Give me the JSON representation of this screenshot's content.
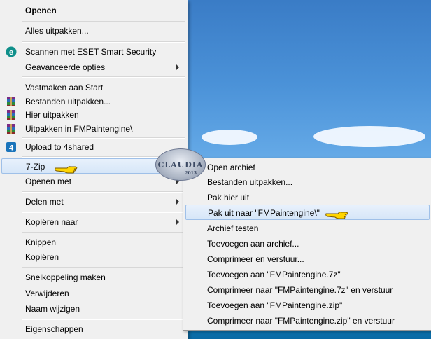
{
  "menu": {
    "items": [
      {
        "label": "Openen",
        "bold": true
      },
      {
        "label": "Alles uitpakken..."
      },
      {
        "label": "Scannen met ESET Smart Security",
        "icon": "eset-icon"
      },
      {
        "label": "Geavanceerde opties",
        "submenu": true
      },
      {
        "label": "Vastmaken aan Start"
      },
      {
        "label": "Bestanden uitpakken...",
        "icon": "winrar-icon"
      },
      {
        "label": "Hier uitpakken",
        "icon": "winrar-icon"
      },
      {
        "label": "Uitpakken in FMPaintengine\\",
        "icon": "winrar-icon"
      },
      {
        "label": "Upload to 4shared",
        "icon": "4shared-icon"
      },
      {
        "label": "7-Zip",
        "submenu": true,
        "highlighted": true
      },
      {
        "label": "Openen met",
        "submenu": true
      },
      {
        "label": "Delen met",
        "submenu": true
      },
      {
        "label": "Kopiëren naar",
        "submenu": true
      },
      {
        "label": "Knippen"
      },
      {
        "label": "Kopiëren"
      },
      {
        "label": "Snelkoppeling maken"
      },
      {
        "label": "Verwijderen"
      },
      {
        "label": "Naam wijzigen"
      },
      {
        "label": "Eigenschappen"
      }
    ]
  },
  "submenu": {
    "items": [
      {
        "label": "Open archief"
      },
      {
        "label": "Bestanden uitpakken..."
      },
      {
        "label": "Pak hier uit"
      },
      {
        "label": "Pak uit naar \"FMPaintengine\\\"",
        "highlighted": true
      },
      {
        "label": "Archief testen"
      },
      {
        "label": "Toevoegen aan archief..."
      },
      {
        "label": "Comprimeer en verstuur..."
      },
      {
        "label": "Toevoegen aan \"FMPaintengine.7z\""
      },
      {
        "label": "Comprimeer naar \"FMPaintengine.7z\" en verstuur"
      },
      {
        "label": "Toevoegen aan \"FMPaintengine.zip\""
      },
      {
        "label": "Comprimeer naar \"FMPaintengine.zip\" en verstuur"
      }
    ]
  },
  "watermark": {
    "text": "CLAUDIA",
    "year": "2013"
  },
  "colors": {
    "highlight": "#d6e6f8",
    "highlight_border": "#9fc0e8",
    "menu_bg": "#f0f0f0"
  }
}
